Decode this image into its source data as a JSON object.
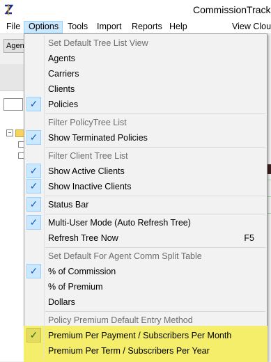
{
  "window": {
    "title": "CommissionTrack"
  },
  "menubar": [
    "File",
    "Options",
    "Tools",
    "Import",
    "Reports",
    "Help",
    "View Clouds"
  ],
  "background": {
    "agent_button_label": "Agent"
  },
  "menu": {
    "tree_header": "Set Default Tree List View",
    "tree_items": [
      {
        "label": "Agents",
        "checked": false
      },
      {
        "label": "Carriers",
        "checked": false
      },
      {
        "label": "Clients",
        "checked": false
      },
      {
        "label": "Policies",
        "checked": true
      }
    ],
    "policy_header": "Filter PolicyTree List",
    "policy_items": [
      {
        "label": "Show Terminated Policies",
        "checked": true
      }
    ],
    "client_header": "Filter Client Tree List",
    "client_items": [
      {
        "label": "Show Active Clients",
        "checked": true
      },
      {
        "label": "Show Inactive Clients",
        "checked": true
      }
    ],
    "status_bar": {
      "label": "Status Bar",
      "checked": true
    },
    "multi_user": {
      "label": "Multi-User Mode (Auto Refresh Tree)",
      "checked": true
    },
    "refresh": {
      "label": "Refresh Tree Now",
      "shortcut": "F5"
    },
    "split_header": "Set Default For Agent Comm Split Table",
    "split_items": [
      {
        "label": "% of Commission",
        "checked": true
      },
      {
        "label": "% of Premium",
        "checked": false
      },
      {
        "label": "Dollars",
        "checked": false
      }
    ],
    "premium_header": "Policy Premium Default Entry Method",
    "premium_items": [
      {
        "label": "Premium Per Payment / Subscribers Per Month",
        "checked": true
      },
      {
        "label": "Premium Per Term / Subscribers Per Year",
        "checked": false
      }
    ],
    "check_glyph": "✓",
    "highlight_color": "#f4ee6a"
  }
}
